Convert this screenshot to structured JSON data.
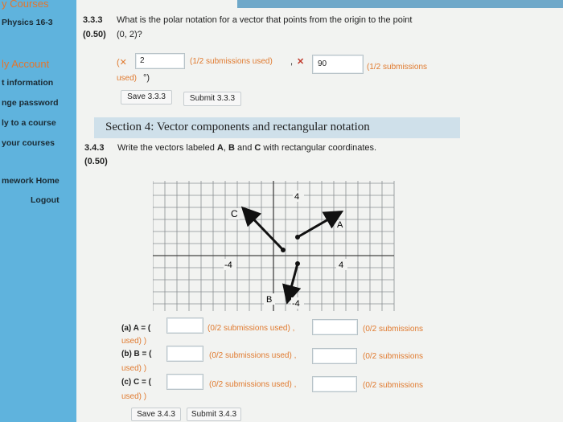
{
  "sidebar": {
    "items": [
      {
        "label": "y Courses"
      },
      {
        "label": "Physics 16-3"
      },
      {
        "label": "ly Account"
      },
      {
        "label": "t information"
      },
      {
        "label": "nge password"
      },
      {
        "label": "ly to a course"
      },
      {
        "label": "your courses"
      },
      {
        "label": "mework Home"
      },
      {
        "label": "Logout"
      }
    ]
  },
  "q333": {
    "number": "3.3.3",
    "points": "(0.50)",
    "text_line1": "What is the polar notation for a vector that points from the origin to the point",
    "text_line2": "(0, 2)?",
    "paren_open": "(✕",
    "input1_value": "2",
    "sub1": "(1/2 submissions used)",
    "comma": ",",
    "x_mark": "✕",
    "input2_value": "90",
    "sub2": "(1/2 submissions",
    "sub2_cont": "used)",
    "deg_close": "°)",
    "save": "Save 3.3.3",
    "submit": "Submit 3.3.3"
  },
  "section": {
    "title": "Section 4: Vector components and rectangular notation"
  },
  "q343": {
    "number": "3.4.3",
    "points": "(0.50)",
    "text_pre": "Write the vectors labeled ",
    "A": "A",
    "sep1": ", ",
    "B": "B",
    "sep2": " and ",
    "C": "C",
    "text_post": " with rectangular coordinates.",
    "rows": [
      {
        "label": "(a) A = (",
        "sub_left": "(0/2 submissions used) ,",
        "sub_right": "(0/2 submissions",
        "cont": "used) )"
      },
      {
        "label": "(b) B = (",
        "sub_left": "(0/2 submissions used) ,",
        "sub_right": "(0/2 submissions",
        "cont": "used) )"
      },
      {
        "label": "(c) C = (",
        "sub_left": "(0/2 submissions used) ,",
        "sub_right": "(0/2 submissions",
        "cont": "used) )"
      }
    ],
    "save": "Save 3.4.3",
    "submit": "Submit 3.4.3"
  },
  "graph": {
    "tick_top": "4",
    "tick_left": "-4",
    "tick_right": "4",
    "tick_bottom": "-4",
    "label_A": "A",
    "label_B": "B",
    "label_C": "C"
  }
}
